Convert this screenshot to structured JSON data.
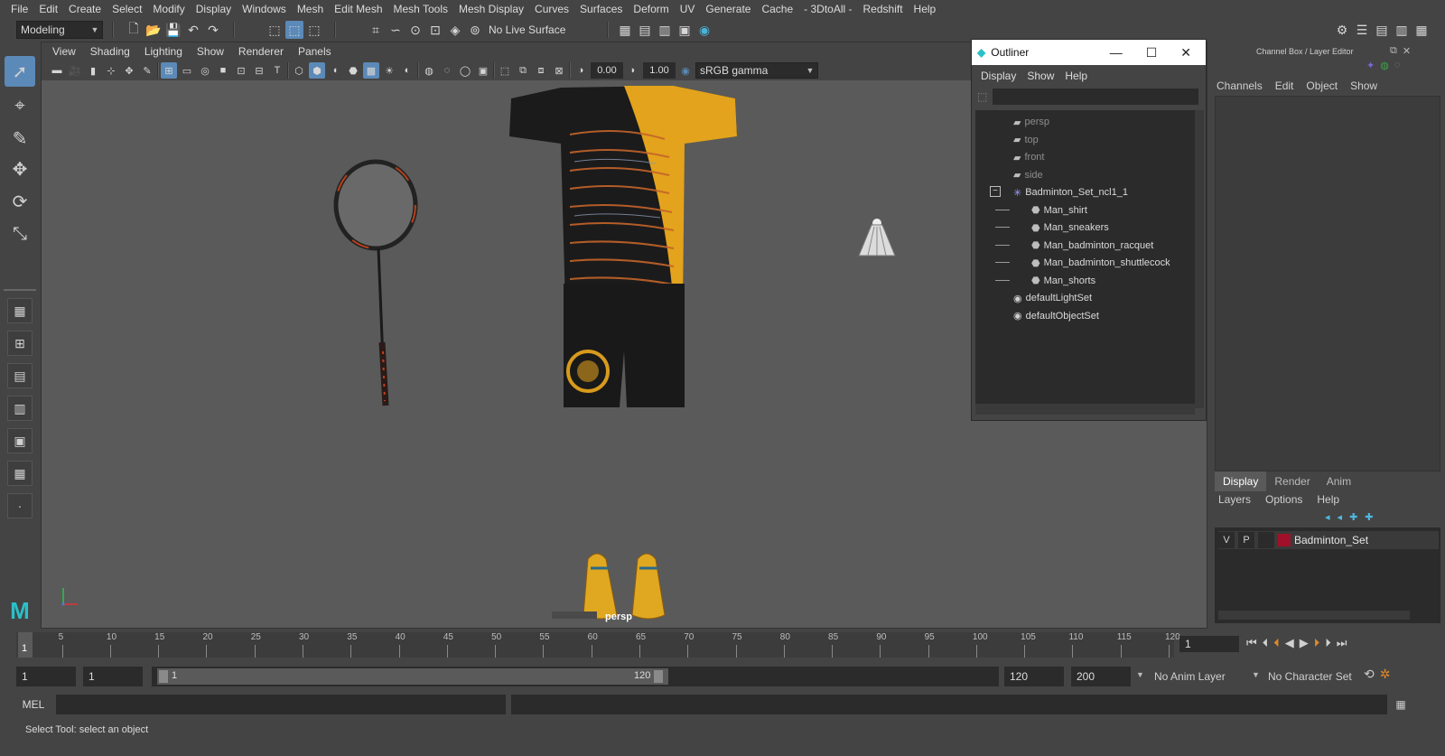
{
  "menubar": [
    "File",
    "Edit",
    "Create",
    "Select",
    "Modify",
    "Display",
    "Windows",
    "Mesh",
    "Edit Mesh",
    "Mesh Tools",
    "Mesh Display",
    "Curves",
    "Surfaces",
    "Deform",
    "UV",
    "Generate",
    "Cache",
    "- 3DtoAll -",
    "Redshift",
    "Help"
  ],
  "statusline": {
    "mode": "Modeling",
    "live_surface": "No Live Surface"
  },
  "viewport": {
    "menu": [
      "View",
      "Shading",
      "Lighting",
      "Show",
      "Renderer",
      "Panels"
    ],
    "exposure": "0.00",
    "gamma": "1.00",
    "color_space": "sRGB gamma",
    "camera_label": "persp"
  },
  "outliner": {
    "title": "Outliner",
    "menu": [
      "Display",
      "Show",
      "Help"
    ],
    "items": [
      {
        "label": "persp",
        "kind": "camera",
        "indent": 0,
        "dim": true
      },
      {
        "label": "top",
        "kind": "camera",
        "indent": 0,
        "dim": true
      },
      {
        "label": "front",
        "kind": "camera",
        "indent": 0,
        "dim": true
      },
      {
        "label": "side",
        "kind": "camera",
        "indent": 0,
        "dim": true
      },
      {
        "label": "Badminton_Set_ncl1_1",
        "kind": "set",
        "indent": 0,
        "dim": false
      },
      {
        "label": "Man_shirt",
        "kind": "mesh",
        "indent": 1,
        "dim": false
      },
      {
        "label": "Man_sneakers",
        "kind": "mesh",
        "indent": 1,
        "dim": false
      },
      {
        "label": "Man_badminton_racquet",
        "kind": "mesh",
        "indent": 1,
        "dim": false
      },
      {
        "label": "Man_badminton_shuttlecock",
        "kind": "mesh",
        "indent": 1,
        "dim": false
      },
      {
        "label": "Man_shorts",
        "kind": "mesh",
        "indent": 1,
        "dim": false
      },
      {
        "label": "defaultLightSet",
        "kind": "objset",
        "indent": 0,
        "dim": false
      },
      {
        "label": "defaultObjectSet",
        "kind": "objset",
        "indent": 0,
        "dim": false
      }
    ]
  },
  "channelbox": {
    "title": "Channel Box / Layer Editor",
    "menu": [
      "Channels",
      "Edit",
      "Object",
      "Show"
    ],
    "tabs": [
      "Display",
      "Render",
      "Anim"
    ],
    "layer_menu": [
      "Layers",
      "Options",
      "Help"
    ],
    "layer": {
      "v": "V",
      "p": "P",
      "name": "Badminton_Set",
      "color": "#a0102a"
    }
  },
  "timeline": {
    "ticks": [
      "5",
      "10",
      "15",
      "20",
      "25",
      "30",
      "35",
      "40",
      "45",
      "50",
      "55",
      "60",
      "65",
      "70",
      "75",
      "80",
      "85",
      "90",
      "95",
      "100",
      "105",
      "110",
      "115",
      "120"
    ],
    "current_frame_marker": "1",
    "current_frame": "1"
  },
  "range": {
    "start": "1",
    "playback_start": "1",
    "slider_start": "1",
    "slider_end": "120",
    "playback_end": "120",
    "end": "200",
    "anim_layer": "No Anim Layer",
    "character_set": "No Character Set"
  },
  "cmdline": {
    "label": "MEL"
  },
  "helpline": {
    "text": "Select Tool: select an object"
  }
}
